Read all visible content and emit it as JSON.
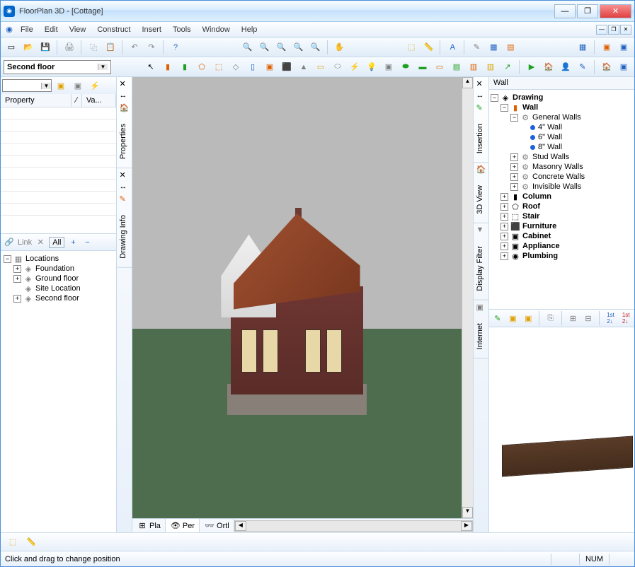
{
  "title": "FloorPlan 3D - [Cottage]",
  "menu": [
    "File",
    "Edit",
    "View",
    "Construct",
    "Insert",
    "Tools",
    "Window",
    "Help"
  ],
  "floor_selector": "Second floor",
  "property_panel": {
    "col1": "Property",
    "col2": "Va..."
  },
  "locations": {
    "toolbar": {
      "link": "Link",
      "all": "All"
    },
    "root": "Locations",
    "items": [
      "Foundation",
      "Ground floor",
      "Site Location",
      "Second floor"
    ]
  },
  "left_tabs": [
    "Properties",
    "Drawing Info"
  ],
  "right_tabs": [
    "Insertion",
    "3D View",
    "Display Filter",
    "Internet"
  ],
  "view_tabs": {
    "plan": "Pla",
    "persp": "Per",
    "orth": "Ortl"
  },
  "wall_panel": {
    "header": "Wall",
    "root": "Drawing",
    "wall": "Wall",
    "general": "General Walls",
    "sizes": [
      "4\" Wall",
      "6\" Wall",
      "8\" Wall"
    ],
    "types": [
      "Stud Walls",
      "Masonry Walls",
      "Concrete Walls",
      "Invisible Walls"
    ],
    "categories": [
      "Column",
      "Roof",
      "Stair",
      "Furniture",
      "Cabinet",
      "Appliance",
      "Plumbing"
    ]
  },
  "status": {
    "hint": "Click and drag to change position",
    "num": "NUM"
  }
}
